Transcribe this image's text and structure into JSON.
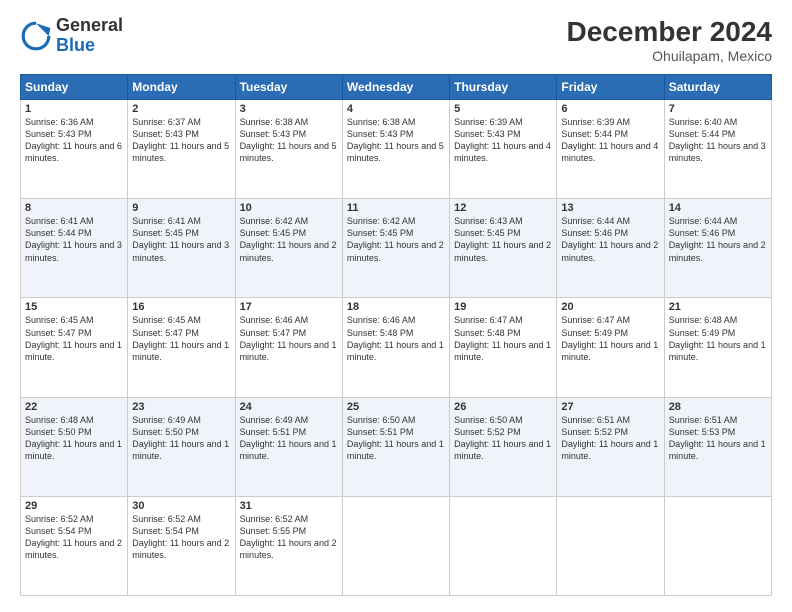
{
  "header": {
    "logo": {
      "general": "General",
      "blue": "Blue"
    },
    "title": "December 2024",
    "location": "Ohuilapam, Mexico"
  },
  "calendar": {
    "days_of_week": [
      "Sunday",
      "Monday",
      "Tuesday",
      "Wednesday",
      "Thursday",
      "Friday",
      "Saturday"
    ],
    "weeks": [
      [
        {
          "day": "1",
          "sunrise": "6:36 AM",
          "sunset": "5:43 PM",
          "daylight": "11 hours and 6 minutes."
        },
        {
          "day": "2",
          "sunrise": "6:37 AM",
          "sunset": "5:43 PM",
          "daylight": "11 hours and 5 minutes."
        },
        {
          "day": "3",
          "sunrise": "6:38 AM",
          "sunset": "5:43 PM",
          "daylight": "11 hours and 5 minutes."
        },
        {
          "day": "4",
          "sunrise": "6:38 AM",
          "sunset": "5:43 PM",
          "daylight": "11 hours and 5 minutes."
        },
        {
          "day": "5",
          "sunrise": "6:39 AM",
          "sunset": "5:43 PM",
          "daylight": "11 hours and 4 minutes."
        },
        {
          "day": "6",
          "sunrise": "6:39 AM",
          "sunset": "5:44 PM",
          "daylight": "11 hours and 4 minutes."
        },
        {
          "day": "7",
          "sunrise": "6:40 AM",
          "sunset": "5:44 PM",
          "daylight": "11 hours and 3 minutes."
        }
      ],
      [
        {
          "day": "8",
          "sunrise": "6:41 AM",
          "sunset": "5:44 PM",
          "daylight": "11 hours and 3 minutes."
        },
        {
          "day": "9",
          "sunrise": "6:41 AM",
          "sunset": "5:45 PM",
          "daylight": "11 hours and 3 minutes."
        },
        {
          "day": "10",
          "sunrise": "6:42 AM",
          "sunset": "5:45 PM",
          "daylight": "11 hours and 2 minutes."
        },
        {
          "day": "11",
          "sunrise": "6:42 AM",
          "sunset": "5:45 PM",
          "daylight": "11 hours and 2 minutes."
        },
        {
          "day": "12",
          "sunrise": "6:43 AM",
          "sunset": "5:45 PM",
          "daylight": "11 hours and 2 minutes."
        },
        {
          "day": "13",
          "sunrise": "6:44 AM",
          "sunset": "5:46 PM",
          "daylight": "11 hours and 2 minutes."
        },
        {
          "day": "14",
          "sunrise": "6:44 AM",
          "sunset": "5:46 PM",
          "daylight": "11 hours and 2 minutes."
        }
      ],
      [
        {
          "day": "15",
          "sunrise": "6:45 AM",
          "sunset": "5:47 PM",
          "daylight": "11 hours and 1 minute."
        },
        {
          "day": "16",
          "sunrise": "6:45 AM",
          "sunset": "5:47 PM",
          "daylight": "11 hours and 1 minute."
        },
        {
          "day": "17",
          "sunrise": "6:46 AM",
          "sunset": "5:47 PM",
          "daylight": "11 hours and 1 minute."
        },
        {
          "day": "18",
          "sunrise": "6:46 AM",
          "sunset": "5:48 PM",
          "daylight": "11 hours and 1 minute."
        },
        {
          "day": "19",
          "sunrise": "6:47 AM",
          "sunset": "5:48 PM",
          "daylight": "11 hours and 1 minute."
        },
        {
          "day": "20",
          "sunrise": "6:47 AM",
          "sunset": "5:49 PM",
          "daylight": "11 hours and 1 minute."
        },
        {
          "day": "21",
          "sunrise": "6:48 AM",
          "sunset": "5:49 PM",
          "daylight": "11 hours and 1 minute."
        }
      ],
      [
        {
          "day": "22",
          "sunrise": "6:48 AM",
          "sunset": "5:50 PM",
          "daylight": "11 hours and 1 minute."
        },
        {
          "day": "23",
          "sunrise": "6:49 AM",
          "sunset": "5:50 PM",
          "daylight": "11 hours and 1 minute."
        },
        {
          "day": "24",
          "sunrise": "6:49 AM",
          "sunset": "5:51 PM",
          "daylight": "11 hours and 1 minute."
        },
        {
          "day": "25",
          "sunrise": "6:50 AM",
          "sunset": "5:51 PM",
          "daylight": "11 hours and 1 minute."
        },
        {
          "day": "26",
          "sunrise": "6:50 AM",
          "sunset": "5:52 PM",
          "daylight": "11 hours and 1 minute."
        },
        {
          "day": "27",
          "sunrise": "6:51 AM",
          "sunset": "5:52 PM",
          "daylight": "11 hours and 1 minute."
        },
        {
          "day": "28",
          "sunrise": "6:51 AM",
          "sunset": "5:53 PM",
          "daylight": "11 hours and 1 minute."
        }
      ],
      [
        {
          "day": "29",
          "sunrise": "6:52 AM",
          "sunset": "5:54 PM",
          "daylight": "11 hours and 2 minutes."
        },
        {
          "day": "30",
          "sunrise": "6:52 AM",
          "sunset": "5:54 PM",
          "daylight": "11 hours and 2 minutes."
        },
        {
          "day": "31",
          "sunrise": "6:52 AM",
          "sunset": "5:55 PM",
          "daylight": "11 hours and 2 minutes."
        },
        null,
        null,
        null,
        null
      ]
    ]
  }
}
